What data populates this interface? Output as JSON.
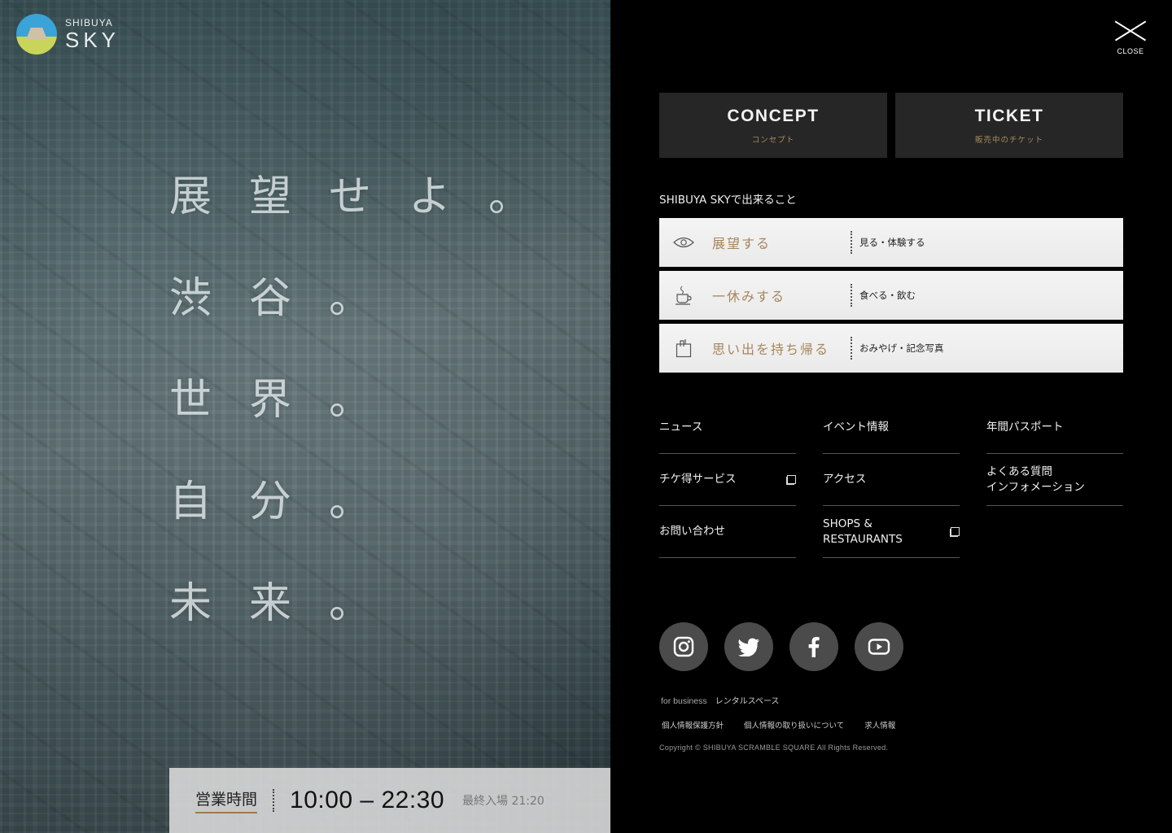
{
  "logo": {
    "small": "SHIBUYA",
    "big": "SKY"
  },
  "poem": [
    "展望せよ。",
    "渋谷。",
    "世界。",
    "自分。",
    "未来。"
  ],
  "hours": {
    "label": "営業時間",
    "time": "10:00 – 22:30",
    "last_entry": "最終入場 21:20"
  },
  "close": {
    "label": "CLOSE"
  },
  "big_buttons": [
    {
      "title": "CONCEPT",
      "sub": "コンセプト"
    },
    {
      "title": "TICKET",
      "sub": "販売中のチケット"
    }
  ],
  "can_do": {
    "title": "SHIBUYA SKYで出来ること",
    "items": [
      {
        "icon": "eye-icon",
        "label": "展望する",
        "sub": "見る・体験する"
      },
      {
        "icon": "coffee-cup-icon",
        "label": "一休みする",
        "sub": "食べる・飲む"
      },
      {
        "icon": "shopping-bag-icon",
        "label": "思い出を持ち帰る",
        "sub": "おみやげ・記念写真"
      }
    ]
  },
  "links": {
    "col1": [
      "ニュース",
      "チケ得サービス",
      "お問い合わせ"
    ],
    "col2": [
      "イベント情報",
      "アクセス",
      "SHOPS &\nRESTAURANTS"
    ],
    "col3": [
      "年間パスポート",
      "よくある質問\nインフォメーション"
    ]
  },
  "socials": [
    "instagram-icon",
    "twitter-icon",
    "facebook-icon",
    "youtube-icon"
  ],
  "footer": {
    "for_business": "for business",
    "rental": "レンタルスペース",
    "privacy_policy": "個人情報保護方針",
    "privacy_handling": "個人情報の取り扱いについて",
    "recruit": "求人情報",
    "copyright": "Copyright © SHIBUYA SCRAMBLE SQUARE All Rights Reserved."
  },
  "colors": {
    "accent_gold": "#a5865c",
    "menu_bg": "#000000",
    "button_bg": "#262626"
  }
}
